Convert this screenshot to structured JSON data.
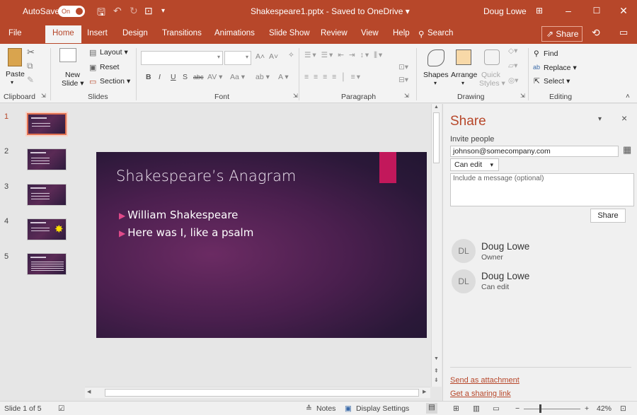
{
  "titlebar": {
    "autosave_label": "AutoSave",
    "autosave_state": "On",
    "document_title": "Shakespeare1.pptx - Saved to OneDrive ▾",
    "user_name": "Doug Lowe"
  },
  "tabs": [
    "File",
    "Home",
    "Insert",
    "Design",
    "Transitions",
    "Animations",
    "Slide Show",
    "Review",
    "View",
    "Help"
  ],
  "search_label": "Search",
  "share_label": "Share",
  "ribbon": {
    "clipboard": {
      "paste": "Paste",
      "group": "Clipboard"
    },
    "slides": {
      "new_slide_1": "New",
      "new_slide_2": "Slide ▾",
      "layout": "Layout ▾",
      "reset": "Reset",
      "section": "Section ▾",
      "group": "Slides"
    },
    "font": {
      "bold": "B",
      "italic": "I",
      "underline": "U",
      "shadow": "S",
      "strike": "abc",
      "group": "Font"
    },
    "paragraph": {
      "group": "Paragraph"
    },
    "drawing": {
      "shapes": "Shapes",
      "arrange": "Arrange",
      "quick_styles_1": "Quick",
      "quick_styles_2": "Styles ▾",
      "group": "Drawing"
    },
    "editing": {
      "find": "Find",
      "replace": "Replace ▾",
      "select": "Select ▾",
      "group": "Editing"
    }
  },
  "thumbnails": [
    "1",
    "2",
    "3",
    "4",
    "5"
  ],
  "slide": {
    "title": "Shakespeare’s Anagram",
    "bullets": [
      "William Shakespeare",
      "Here was I, like a psalm"
    ]
  },
  "share_pane": {
    "title": "Share",
    "invite_label": "Invite people",
    "invite_value": "johnson@somecompany.com",
    "permission": "Can edit",
    "message_placeholder": "Include a message (optional)",
    "share_button": "Share",
    "people": [
      {
        "initials": "DL",
        "name": "Doug Lowe",
        "role": "Owner"
      },
      {
        "initials": "DL",
        "name": "Doug Lowe",
        "role": "Can edit"
      }
    ],
    "send_attachment": "Send as attachment",
    "sharing_link": "Get a sharing link"
  },
  "status": {
    "slide_indicator": "Slide 1 of 5",
    "notes": "Notes",
    "display_settings": "Display Settings",
    "zoom": "42%"
  },
  "colors": {
    "accent": "#b7472a",
    "slide_accent": "#c2185b"
  }
}
